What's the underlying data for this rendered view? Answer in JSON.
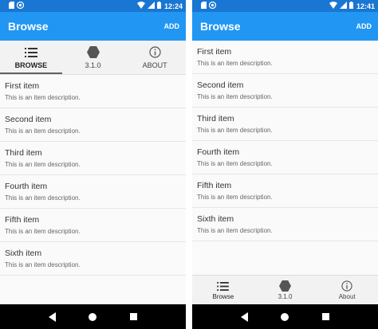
{
  "left": {
    "status": {
      "time": "12:24"
    },
    "appbar": {
      "title": "Browse",
      "action": "ADD"
    },
    "tabs": [
      {
        "label": "BROWSE",
        "icon": "list-icon"
      },
      {
        "label": "3.1.0",
        "icon": "hexagon-icon"
      },
      {
        "label": "ABOUT",
        "icon": "info-icon"
      }
    ],
    "items": [
      {
        "name": "First item",
        "desc": "This is an item description."
      },
      {
        "name": "Second item",
        "desc": "This is an item description."
      },
      {
        "name": "Third item",
        "desc": "This is an item description."
      },
      {
        "name": "Fourth item",
        "desc": "This is an item description."
      },
      {
        "name": "Fifth item",
        "desc": "This is an item description."
      },
      {
        "name": "Sixth item",
        "desc": "This is an item description."
      }
    ]
  },
  "right": {
    "status": {
      "time": "12:41"
    },
    "appbar": {
      "title": "Browse",
      "action": "ADD"
    },
    "items": [
      {
        "name": "First item",
        "desc": "This is an item description."
      },
      {
        "name": "Second item",
        "desc": "This is an item description."
      },
      {
        "name": "Third item",
        "desc": "This is an item description."
      },
      {
        "name": "Fourth item",
        "desc": "This is an item description."
      },
      {
        "name": "Fifth item",
        "desc": "This is an item description."
      },
      {
        "name": "Sixth item",
        "desc": "This is an item description."
      }
    ],
    "bottom_tabs": [
      {
        "label": "Browse",
        "icon": "list-icon"
      },
      {
        "label": "3.1.0",
        "icon": "hexagon-icon"
      },
      {
        "label": "About",
        "icon": "info-icon"
      }
    ]
  },
  "colors": {
    "statusbar": "#1976d2",
    "appbar": "#2196f3",
    "tabbar": "#f2f2f2",
    "navbar": "#000000"
  }
}
